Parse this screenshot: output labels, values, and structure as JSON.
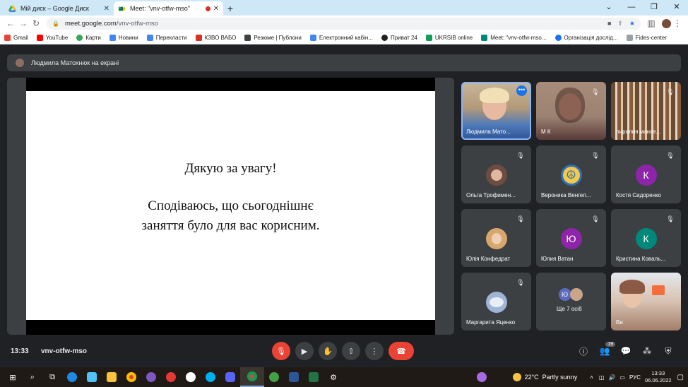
{
  "browser": {
    "tabs": [
      {
        "title": "Мій диск – Google Диск",
        "active": false
      },
      {
        "title": "Meet: \"vnv-otfw-mso\"",
        "active": true,
        "recording": true
      }
    ],
    "new_tab": "+",
    "window_controls": [
      "⌄",
      "—",
      "❐",
      "✕"
    ],
    "url_domain": "meet.google.com",
    "url_path": "/vnv-otfw-mso",
    "bookmarks": [
      {
        "label": "Gmail",
        "color": "#ea4335"
      },
      {
        "label": "YouTube",
        "color": "#ff0000"
      },
      {
        "label": "Карти",
        "color": "#34a853"
      },
      {
        "label": "Новини",
        "color": "#4285f4"
      },
      {
        "label": "Переклaсти",
        "color": "#4285f4"
      },
      {
        "label": "КЗВО ВАБО",
        "color": "#d93025"
      },
      {
        "label": "Резюме | Публони",
        "color": "#3c4043"
      },
      {
        "label": "Електронний кабін...",
        "color": "#4285f4"
      },
      {
        "label": "Приват 24",
        "color": "#202124"
      },
      {
        "label": "UKRSIB online",
        "color": "#0f9d58"
      },
      {
        "label": "Meet: \"vnv-otfw-mso...",
        "color": "#00897b"
      },
      {
        "label": "Організація дослід...",
        "color": "#1a73e8"
      },
      {
        "label": "Fides-center",
        "color": "#9aa0a6"
      }
    ]
  },
  "meet": {
    "presenter_banner": "Людмила Матохнюк на екрані",
    "slide": {
      "line1": "Дякую за увагу!",
      "line2": "Сподіваюсь, що сьогоднішнє",
      "line3": "заняття було для вас корисним."
    },
    "participants": [
      {
        "name": "Людмила Мато...",
        "type": "video"
      },
      {
        "name": "М К",
        "type": "video"
      },
      {
        "name": "лиралия монсе...",
        "type": "video"
      },
      {
        "name": "Ольга Трофимен...",
        "type": "photo"
      },
      {
        "name": "Вероника Венгел...",
        "type": "photo"
      },
      {
        "name": "Костя Сидоренко",
        "type": "letter",
        "letter": "К",
        "color": "#8e24aa"
      },
      {
        "name": "Юлія Конфедрат",
        "type": "photo"
      },
      {
        "name": "Юлия Ватан",
        "type": "letter",
        "letter": "Ю",
        "color": "#8e24aa"
      },
      {
        "name": "Кристина Коваль...",
        "type": "letter",
        "letter": "К",
        "color": "#00897b"
      },
      {
        "name": "Маргарита Яценко",
        "type": "photo"
      },
      {
        "name": "Ще 7 осіб",
        "type": "more",
        "letter": "Ю"
      },
      {
        "name": "Ви",
        "type": "video"
      }
    ],
    "meeting_time": "13:33",
    "meeting_code": "vnv-otfw-mso",
    "people_count": "19"
  },
  "taskbar": {
    "weather_temp": "22°C",
    "weather_text": "Partly sunny",
    "lang": "РУС",
    "time": "13:33",
    "date": "06.06.2022"
  }
}
